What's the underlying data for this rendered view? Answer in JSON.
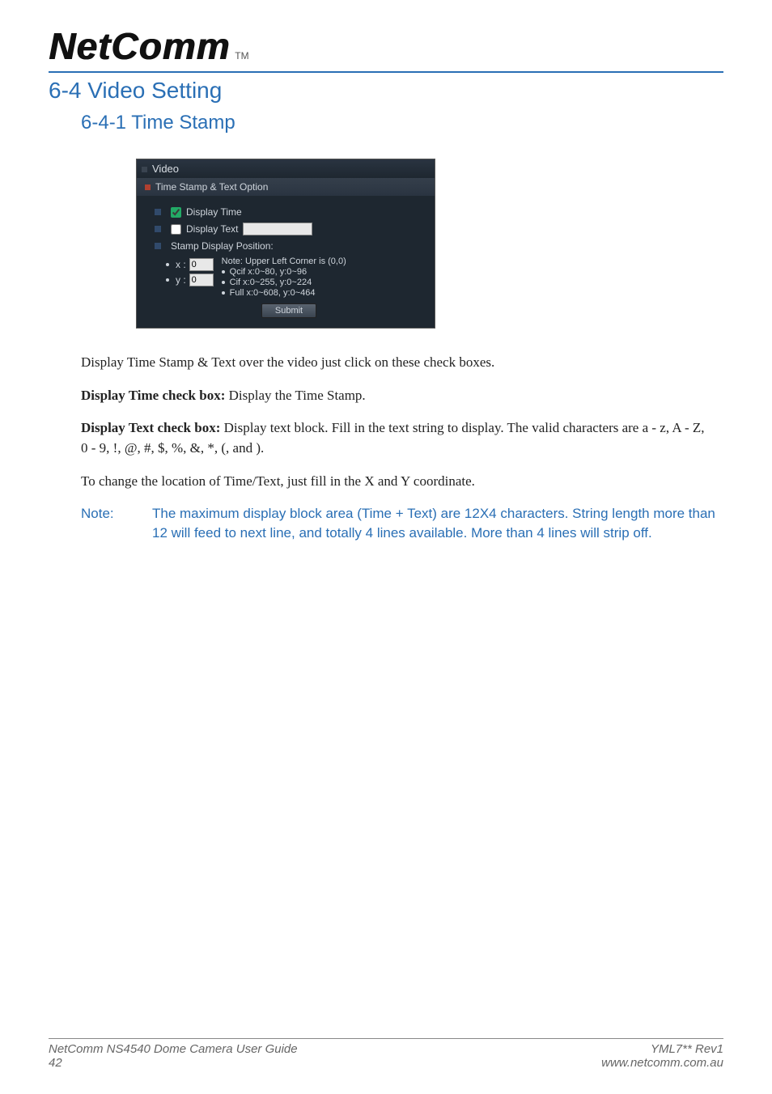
{
  "header": {
    "logo_text": "NetComm",
    "tm": "TM"
  },
  "headings": {
    "section": "6-4 Video Setting",
    "subsection": "6-4-1 Time Stamp"
  },
  "screenshot": {
    "titlebar": "Video",
    "section_bar": "Time Stamp & Text Option",
    "display_time_label": "Display Time",
    "display_time_checked": true,
    "display_text_label": "Display Text",
    "display_text_checked": false,
    "display_text_value": "",
    "stamp_position_label": "Stamp Display Position:",
    "x_label": "x :",
    "x_value": "0",
    "y_label": "y :",
    "y_value": "0",
    "notes": {
      "line1": "Note: Upper Left Corner is (0,0)",
      "line2": "Qcif  x:0~80,   y:0~96",
      "line3": "Cif    x:0~255, y:0~224",
      "line4": "Full  x:0~608, y:0~464"
    },
    "submit_label": "Submit"
  },
  "body": {
    "p1": "Display Time Stamp & Text over the video just click on these check boxes.",
    "p2_strong": "Display Time check box:",
    "p2_rest": " Display the Time Stamp.",
    "p3_strong": "Display Text check box:",
    "p3_rest": " Display text block. Fill in the text string to display. The valid characters are a - z, A - Z, 0 - 9, !, @, #, $, %, &, *, (, and ).",
    "p4": "To change the location of Time/Text, just fill in the X and Y coordinate."
  },
  "note": {
    "label": "Note:",
    "text": "The maximum display block area (Time + Text) are 12X4 characters. String length more than 12 will feed to next line, and totally 4 lines available. More than 4 lines will strip off."
  },
  "footer": {
    "left1": "NetComm NS4540 Dome Camera User Guide",
    "right1": "YML7** Rev1",
    "left2": "42",
    "right2": "www.netcomm.com.au"
  }
}
